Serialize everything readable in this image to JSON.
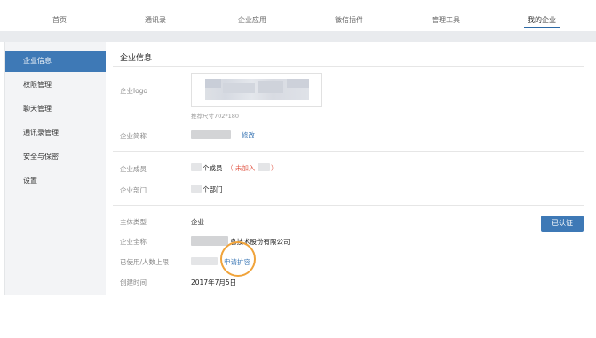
{
  "topnav": {
    "tabs": [
      {
        "label": "首页"
      },
      {
        "label": "通讯录"
      },
      {
        "label": "企业应用"
      },
      {
        "label": "微信插件"
      },
      {
        "label": "管理工具"
      },
      {
        "label": "我的企业"
      }
    ],
    "active_tab": "我的企业"
  },
  "sidebar": {
    "items": [
      {
        "label": "企业信息"
      },
      {
        "label": "权限管理"
      },
      {
        "label": "聊天管理"
      },
      {
        "label": "通讯录管理"
      },
      {
        "label": "安全与保密"
      },
      {
        "label": "设置"
      }
    ],
    "active_item": "企业信息"
  },
  "main": {
    "title": "企业信息",
    "logo_label": "企业logo",
    "logo_hint": "推荐尺寸702*180",
    "short_name_label": "企业简称",
    "edit_link": "修改",
    "members_label": "企业成员",
    "members_suffix": "个成员",
    "not_joined_open": "（ 未加入",
    "not_joined_close": "）",
    "departments_label": "企业部门",
    "departments_suffix": "个部门",
    "entity_type_label": "主体类型",
    "entity_type_value": "企业",
    "full_name_label": "企业全称",
    "full_name_visible": "息技术股份有限公司",
    "usage_label": "已使用/人数上限",
    "expand_link": "申请扩容",
    "created_label": "创建时间",
    "created_value": "2017年7月5日",
    "verified_button": "已认证"
  },
  "colors": {
    "accent": "#3e79b6",
    "warning": "#e25c4c",
    "highlight": "#f0a33a"
  }
}
